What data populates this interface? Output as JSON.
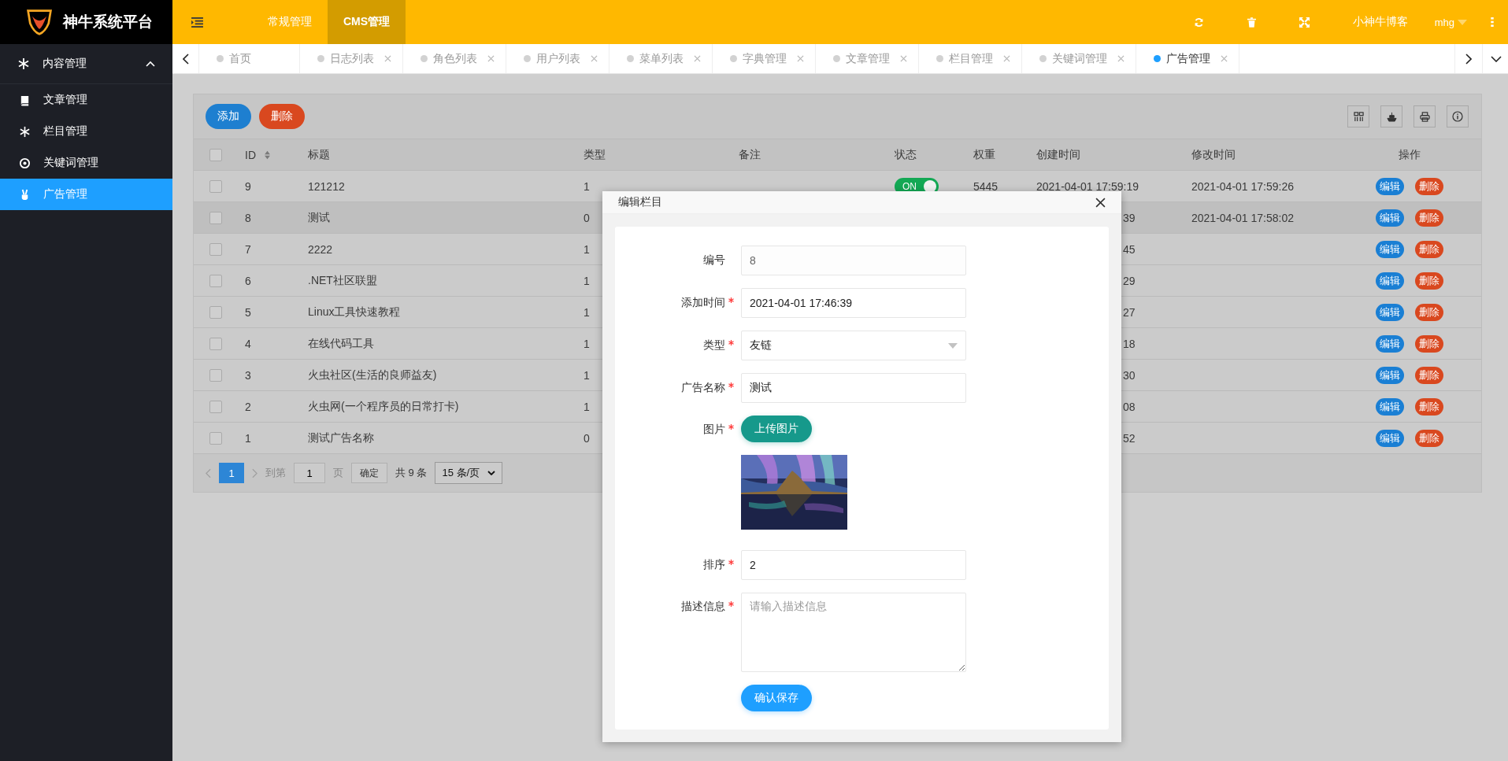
{
  "brand": {
    "title": "神牛系统平台"
  },
  "header": {
    "nav": [
      {
        "label": "常规管理",
        "selected": false
      },
      {
        "label": "CMS管理",
        "selected": true
      }
    ],
    "site_link": "小神牛博客",
    "user": "mhg"
  },
  "sidebar": {
    "group": {
      "label": "内容管理",
      "expanded": true
    },
    "items": [
      {
        "label": "文章管理",
        "selected": false
      },
      {
        "label": "栏目管理",
        "selected": false
      },
      {
        "label": "关键词管理",
        "selected": false
      },
      {
        "label": "广告管理",
        "selected": true
      }
    ]
  },
  "tabs": [
    {
      "label": "首页",
      "closable": false,
      "selected": false
    },
    {
      "label": "日志列表",
      "closable": true,
      "selected": false
    },
    {
      "label": "角色列表",
      "closable": true,
      "selected": false
    },
    {
      "label": "用户列表",
      "closable": true,
      "selected": false
    },
    {
      "label": "菜单列表",
      "closable": true,
      "selected": false
    },
    {
      "label": "字典管理",
      "closable": true,
      "selected": false
    },
    {
      "label": "文章管理",
      "closable": true,
      "selected": false
    },
    {
      "label": "栏目管理",
      "closable": true,
      "selected": false
    },
    {
      "label": "关键词管理",
      "closable": true,
      "selected": false
    },
    {
      "label": "广告管理",
      "closable": true,
      "selected": true
    }
  ],
  "toolbar": {
    "buttons": [
      {
        "label": "添加",
        "kind": "primary"
      },
      {
        "label": "删除",
        "kind": "danger"
      }
    ]
  },
  "table": {
    "select_all": {
      "checked": false
    },
    "columns": [
      {
        "label": "ID",
        "sortable": true
      },
      {
        "label": "标题",
        "sortable": false
      },
      {
        "label": "类型",
        "sortable": false
      },
      {
        "label": "备注",
        "sortable": false
      },
      {
        "label": "状态",
        "sortable": false
      },
      {
        "label": "权重",
        "sortable": false
      },
      {
        "label": "创建时间",
        "sortable": false
      },
      {
        "label": "修改时间",
        "sortable": false
      },
      {
        "label": "操作",
        "sortable": false
      }
    ],
    "rows": [
      {
        "checked": false,
        "hovered": false,
        "id": "9",
        "title": "121212",
        "type": "1",
        "status": {
          "on": true,
          "label": "ON"
        },
        "weight": "5445",
        "created": "2021-04-01 17:59:19",
        "modified": "2021-04-01 17:59:26",
        "actions": [
          {
            "label": "编辑",
            "kind": "edit"
          },
          {
            "label": "删除",
            "kind": "delete"
          }
        ]
      },
      {
        "checked": false,
        "hovered": true,
        "id": "8",
        "title": "测试",
        "type": "0",
        "created": "39",
        "modified": "2021-04-01 17:58:02",
        "actions": [
          {
            "label": "编辑",
            "kind": "edit"
          },
          {
            "label": "删除",
            "kind": "delete"
          }
        ]
      },
      {
        "checked": false,
        "hovered": false,
        "id": "7",
        "title": "2222",
        "type": "1",
        "created": "45",
        "actions": [
          {
            "label": "编辑",
            "kind": "edit"
          },
          {
            "label": "删除",
            "kind": "delete"
          }
        ]
      },
      {
        "checked": false,
        "hovered": false,
        "id": "6",
        "title": ".NET社区联盟",
        "type": "1",
        "created": "29",
        "actions": [
          {
            "label": "编辑",
            "kind": "edit"
          },
          {
            "label": "删除",
            "kind": "delete"
          }
        ]
      },
      {
        "checked": false,
        "hovered": false,
        "id": "5",
        "title": "Linux工具快速教程",
        "type": "1",
        "created": "27",
        "actions": [
          {
            "label": "编辑",
            "kind": "edit"
          },
          {
            "label": "删除",
            "kind": "delete"
          }
        ]
      },
      {
        "checked": false,
        "hovered": false,
        "id": "4",
        "title": "在线代码工具",
        "type": "1",
        "created": "18",
        "actions": [
          {
            "label": "编辑",
            "kind": "edit"
          },
          {
            "label": "删除",
            "kind": "delete"
          }
        ]
      },
      {
        "checked": false,
        "hovered": false,
        "id": "3",
        "title": "火虫社区(生活的良师益友)",
        "type": "1",
        "created": "30",
        "actions": [
          {
            "label": "编辑",
            "kind": "edit"
          },
          {
            "label": "删除",
            "kind": "delete"
          }
        ]
      },
      {
        "checked": false,
        "hovered": false,
        "id": "2",
        "title": "火虫网(一个程序员的日常打卡)",
        "type": "1",
        "created": "08",
        "actions": [
          {
            "label": "编辑",
            "kind": "edit"
          },
          {
            "label": "删除",
            "kind": "delete"
          }
        ]
      },
      {
        "checked": false,
        "hovered": false,
        "id": "1",
        "title": "测试广告名称",
        "type": "0",
        "created": "52",
        "actions": [
          {
            "label": "编辑",
            "kind": "edit"
          },
          {
            "label": "删除",
            "kind": "delete"
          }
        ]
      }
    ]
  },
  "pagination": {
    "pages": [
      {
        "label": "1",
        "selected": true
      }
    ],
    "goto_label": "到第",
    "goto_value": "1",
    "page_unit": "页",
    "confirm": "确定",
    "total": "共 9 条",
    "page_size": "15 条/页"
  },
  "modal": {
    "title": "编辑栏目",
    "fields": [
      {
        "label": "编号",
        "required": false,
        "kind": "text",
        "disabled": true,
        "value": "8"
      },
      {
        "label": "添加时间",
        "required": true,
        "kind": "text",
        "disabled": false,
        "value": "2021-04-01 17:46:39"
      },
      {
        "label": "类型",
        "required": true,
        "kind": "select",
        "disabled": false,
        "value": "友链"
      },
      {
        "label": "广告名称",
        "required": true,
        "kind": "text",
        "disabled": false,
        "value": "测试"
      },
      {
        "label": "图片",
        "required": true,
        "kind": "upload",
        "button": "上传图片"
      },
      {
        "label": "排序",
        "required": true,
        "kind": "text",
        "disabled": false,
        "value": "2"
      },
      {
        "label": "描述信息",
        "required": true,
        "kind": "textarea",
        "disabled": false,
        "placeholder": "请输入描述信息"
      }
    ],
    "submit": "确认保存"
  }
}
